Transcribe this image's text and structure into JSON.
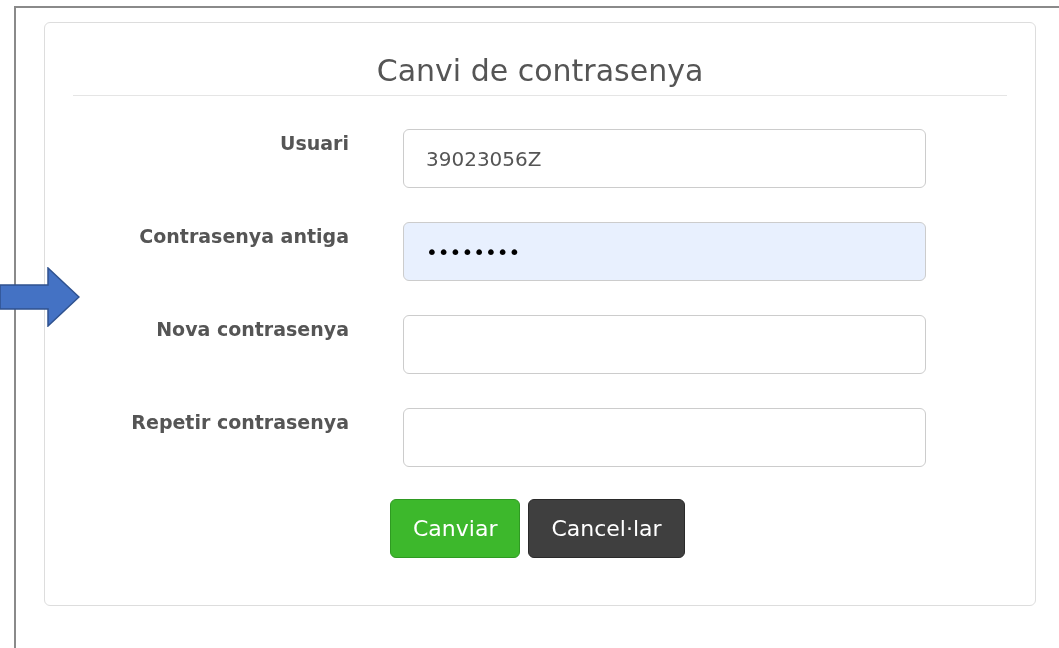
{
  "title": "Canvi de contrasenya",
  "fields": [
    {
      "label": "Usuari",
      "value": "39023056Z",
      "autofilled": false
    },
    {
      "label": "Contrasenya antiga",
      "value": "••••••••",
      "autofilled": true
    },
    {
      "label": "Nova contrasenya",
      "autofilled": false
    },
    {
      "label": "Repetir contrasenya",
      "autofilled": false
    }
  ],
  "buttons": [
    {
      "label": "Canviar",
      "kind": "primary"
    },
    {
      "label": "Cancel·lar",
      "kind": "dark"
    }
  ]
}
